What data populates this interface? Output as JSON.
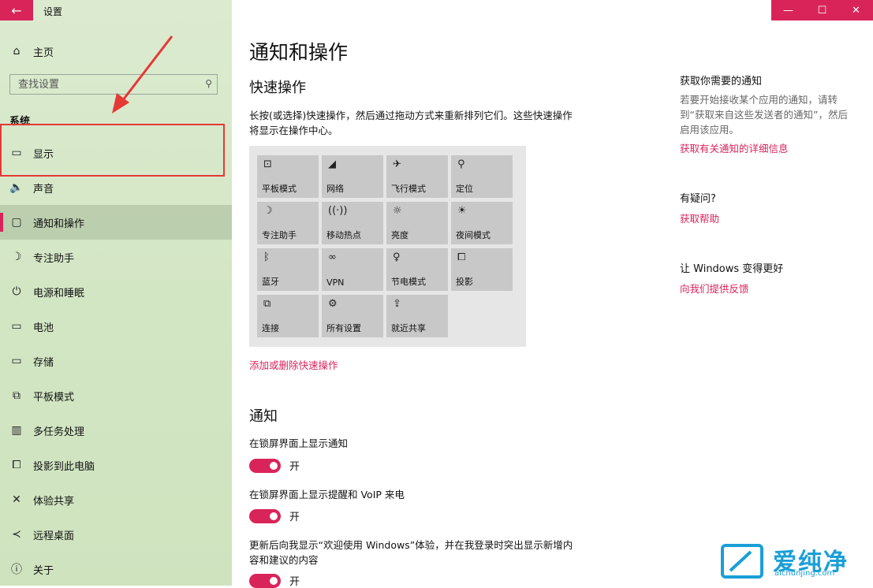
{
  "window": {
    "title": "设置",
    "back": "←",
    "minimize": "—",
    "maximize": "☐",
    "close": "✕"
  },
  "sidebar": {
    "home": "主页",
    "search_placeholder": "查找设置",
    "section": "系统",
    "items": [
      {
        "label": "显示",
        "icon": "display-icon"
      },
      {
        "label": "声音",
        "icon": "speaker-icon"
      },
      {
        "label": "通知和操作",
        "icon": "notification-icon",
        "selected": true
      },
      {
        "label": "专注助手",
        "icon": "moon-icon"
      },
      {
        "label": "电源和睡眠",
        "icon": "power-icon"
      },
      {
        "label": "电池",
        "icon": "battery-icon"
      },
      {
        "label": "存储",
        "icon": "storage-icon"
      },
      {
        "label": "平板模式",
        "icon": "tablet-icon"
      },
      {
        "label": "多任务处理",
        "icon": "multitask-icon"
      },
      {
        "label": "投影到此电脑",
        "icon": "project-icon"
      },
      {
        "label": "体验共享",
        "icon": "share-icon"
      },
      {
        "label": "远程桌面",
        "icon": "remote-desktop-icon"
      },
      {
        "label": "关于",
        "icon": "info-icon"
      }
    ]
  },
  "main": {
    "title": "通知和操作",
    "quick_actions": {
      "heading": "快速操作",
      "description": "长按(或选择)快速操作，然后通过拖动方式来重新排列它们。这些快速操作将显示在操作中心。",
      "tiles": [
        {
          "label": "平板模式",
          "icon": "tablet-mode-icon"
        },
        {
          "label": "网络",
          "icon": "network-icon"
        },
        {
          "label": "飞行模式",
          "icon": "airplane-icon"
        },
        {
          "label": "定位",
          "icon": "location-icon"
        },
        {
          "label": "专注助手",
          "icon": "moon-icon"
        },
        {
          "label": "移动热点",
          "icon": "hotspot-icon"
        },
        {
          "label": "亮度",
          "icon": "brightness-icon"
        },
        {
          "label": "夜间模式",
          "icon": "night-light-icon"
        },
        {
          "label": "蓝牙",
          "icon": "bluetooth-icon"
        },
        {
          "label": "VPN",
          "icon": "vpn-icon"
        },
        {
          "label": "节电模式",
          "icon": "battery-saver-icon"
        },
        {
          "label": "投影",
          "icon": "project-icon"
        },
        {
          "label": "连接",
          "icon": "connect-icon"
        },
        {
          "label": "所有设置",
          "icon": "gear-icon"
        },
        {
          "label": "就近共享",
          "icon": "nearby-share-icon"
        }
      ],
      "edit_link": "添加或删除快速操作"
    },
    "notifications": {
      "heading": "通知",
      "settings": [
        {
          "label": "在锁屏界面上显示通知",
          "state": "开"
        },
        {
          "label": "在锁屏界面上显示提醒和 VoIP 来电",
          "state": "开"
        },
        {
          "label": "更新后向我显示“欢迎使用 Windows”体验，并在我登录时突出显示新增内容和建议的内容",
          "state": "开"
        }
      ]
    }
  },
  "aside": {
    "get_notifications": {
      "heading": "获取你需要的通知",
      "text": "若要开始接收某个应用的通知，请转到“获取来自这些发送者的通知”，然后启用该应用。",
      "link": "获取有关通知的详细信息"
    },
    "questions": {
      "heading": "有疑问?",
      "link": "获取帮助"
    },
    "feedback": {
      "heading": "让 Windows 变得更好",
      "link": "向我们提供反馈"
    }
  },
  "watermark": {
    "text": "爱纯净",
    "url": "aichunjing.com"
  },
  "colors": {
    "accent": "#d9245a",
    "sidebar_bg": "#d3e6c4",
    "annotation_red": "#e53935",
    "watermark_blue": "#1a9fd6"
  }
}
